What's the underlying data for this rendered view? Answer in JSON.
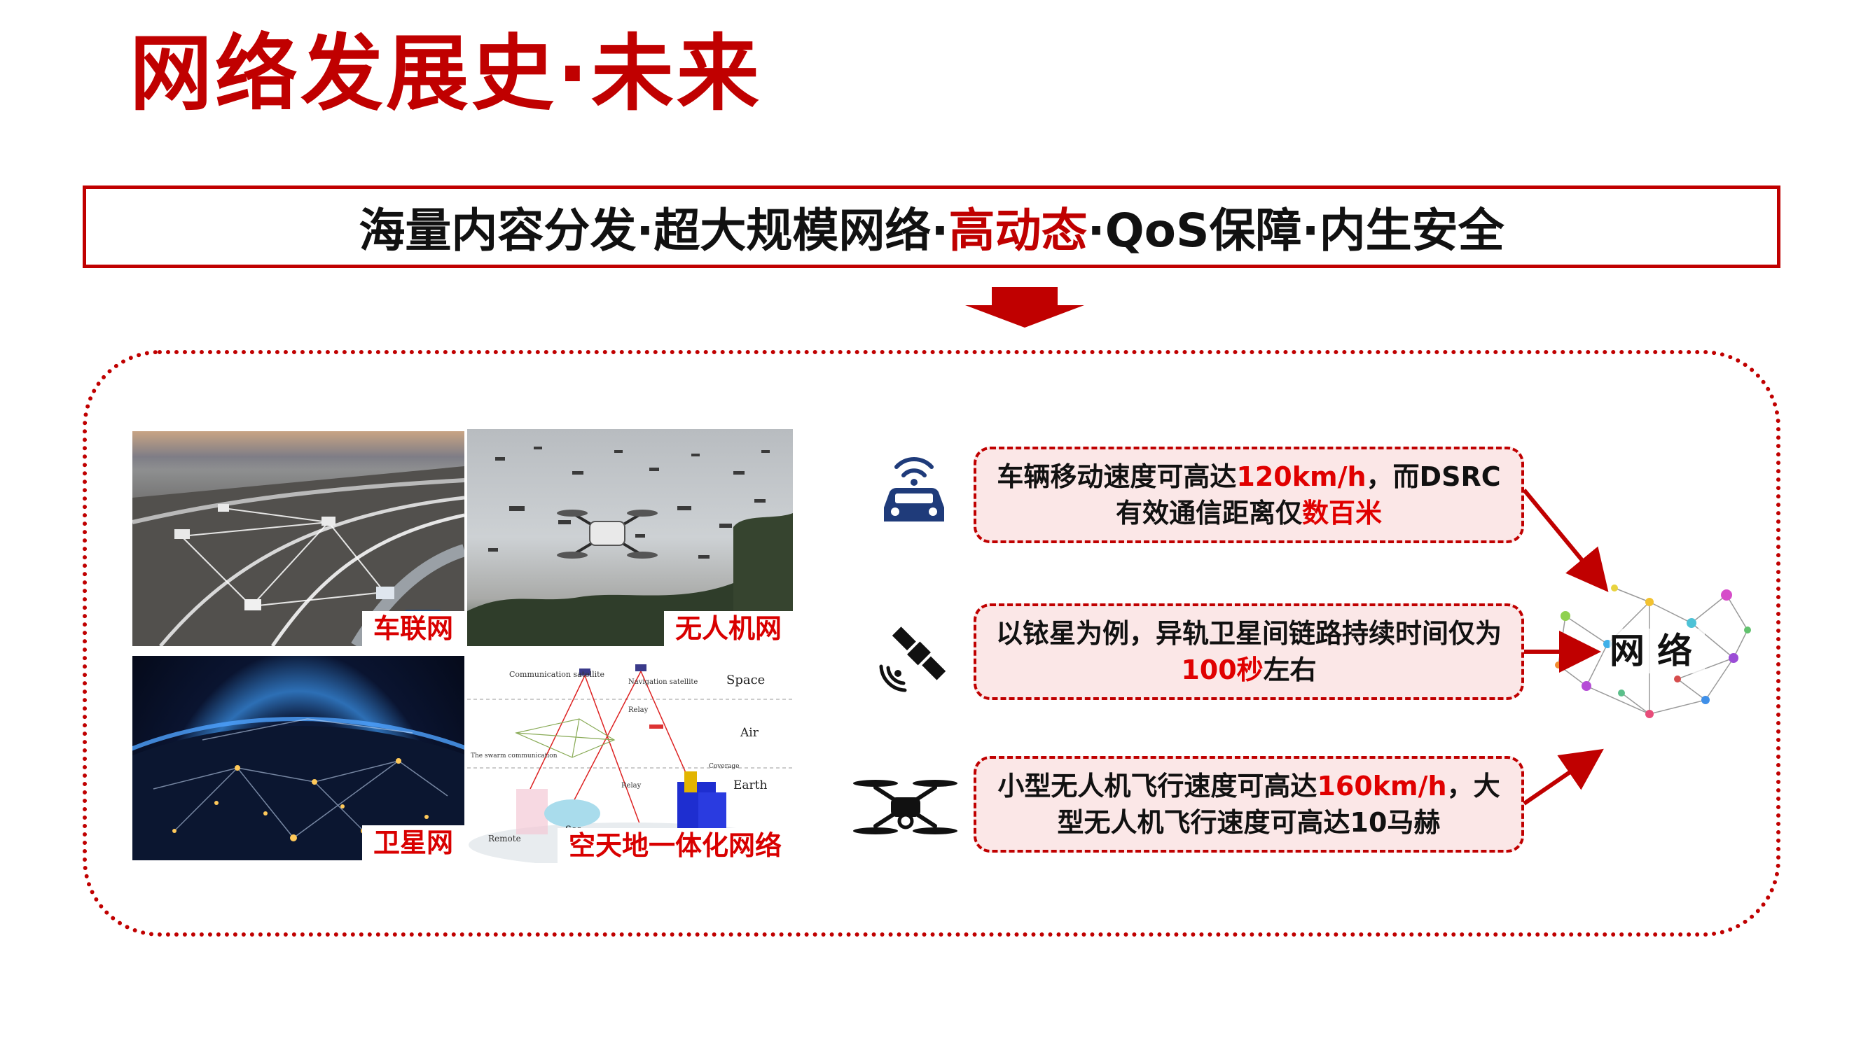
{
  "title": "网络发展史·未来",
  "banner": {
    "part1": "海量内容分发·超大规模网络·",
    "highlight": "高动态",
    "part2": "·QoS保障·内生安全"
  },
  "images": {
    "vehicle_caption": "车联网",
    "uav_caption": "无人机网",
    "satellite_caption": "卫星网",
    "sagin_caption": "空天地一体化网络",
    "sagin_labels": {
      "communication_satellite": "Communication satellite",
      "navigation_satellite": "Navigation satellite",
      "space": "Space",
      "air": "Air",
      "earth": "Earth",
      "sea": "Sea",
      "relay_1": "Relay",
      "relay_2": "Relay",
      "swarm": "The swarm communication",
      "coverage": "Coverage",
      "remote": "Remote"
    }
  },
  "boxes": [
    {
      "text1": "车辆移动速度可高达",
      "hl1": "120km/h",
      "text2": "，而DSRC有效通信距离仅",
      "hl2": "数百米",
      "text3": ""
    },
    {
      "text1": "以铱星为例，异轨卫星间链路持续时间仅为",
      "hl1": "100秒",
      "text2": "左右",
      "hl2": "",
      "text3": ""
    },
    {
      "text1": "小型无人机飞行速度可高达",
      "hl1": "160km/h",
      "text2": "，大型无人机飞行速度可高达10马赫",
      "hl2": "",
      "text3": ""
    }
  ],
  "network_label": "网络",
  "icons": {
    "vehicle": "connected-car-icon",
    "satellite": "satellite-signal-icon",
    "drone": "drone-icon",
    "arrow": "down-arrow-icon"
  },
  "colors": {
    "accent": "#c00000",
    "highlight": "#e00000",
    "box_fill": "#fbe7e7",
    "icon_blue": "#1f3b7a"
  }
}
